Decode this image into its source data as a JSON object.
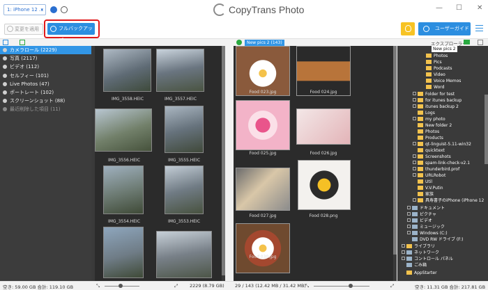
{
  "topbar": {
    "device": "1: iPhone 12 ...",
    "brand": "CopyTrans Photo"
  },
  "toolbar": {
    "apply_label": "変更を適用",
    "backup_label": "フルバックアップ",
    "guide_label": "ユーザーガイド"
  },
  "sidebar": {
    "items": [
      {
        "label": "カメラロール (2229)"
      },
      {
        "label": "写真 (2117)"
      },
      {
        "label": "ビデオ (112)"
      },
      {
        "label": "セルフィー (101)"
      },
      {
        "label": "Live Photos (47)"
      },
      {
        "label": "ポートレート (102)"
      },
      {
        "label": "スクリーンショット (88)"
      },
      {
        "label": "最近削除した項目 (11)"
      }
    ]
  },
  "gallery": {
    "captions": [
      "IMG_3558.HEIC",
      "IMG_3557.HEIC",
      "IMG_3556.HEIC",
      "IMG_3555.HEIC",
      "IMG_3554.HEIC",
      "IMG_3553.HEIC"
    ]
  },
  "album": {
    "tag": "New pics 2 (143)",
    "captions": [
      "Food 023.jpg",
      "Food 024.jpg",
      "Food 025.jpg",
      "Food 026.jpg",
      "Food 027.jpg",
      "Food 028.png",
      "Food 030.jpg"
    ]
  },
  "explorer": {
    "title": "エクスプローラー",
    "selected": "New pics 2",
    "items": [
      "Photos",
      "Pics",
      "Podcasts",
      "Video",
      "Voice Memos",
      "Word",
      "Folder for test",
      "for itunes backup",
      "itunes backup 2",
      "Logs",
      "my photo",
      "New folder 2",
      "Photos",
      "Products",
      "qt-linguist-5.11-win32",
      "quicktext",
      "Screenshots",
      "spam-link-check-v2.1",
      "thunderbird.prof",
      "URLRobot",
      "Util",
      "V.V.Putin",
      "家族",
      "具寿書子のiPhone (iPhone 12",
      "ドキュメント",
      "ピクチャ",
      "ビデオ",
      "ミュージック",
      "Windows (C:)",
      "DVD RW ドライブ (F:)",
      "ライブラリ",
      "ネットワーク",
      "コントロール パネル",
      "ごみ箱",
      "AppStarter"
    ]
  },
  "status": {
    "left": "空き: 59.00 GB 合計: 119.10 GB",
    "mid_left": "2229 (8.79 GB)",
    "mid_right": "29 / 143 (12.42 MB / 31.42 MB)",
    "right": "空き: 11.31 GB 合計: 217.81 GB"
  },
  "colors": {
    "accent": "#2c8ee0",
    "highlight": "#e0191b",
    "selected": "#3296e6"
  }
}
